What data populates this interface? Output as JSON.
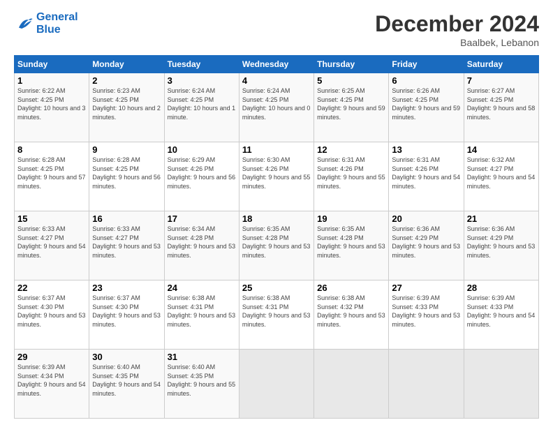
{
  "header": {
    "logo_line1": "General",
    "logo_line2": "Blue",
    "month": "December 2024",
    "location": "Baalbek, Lebanon"
  },
  "weekdays": [
    "Sunday",
    "Monday",
    "Tuesday",
    "Wednesday",
    "Thursday",
    "Friday",
    "Saturday"
  ],
  "weeks": [
    [
      {
        "day": "1",
        "sunrise": "6:22 AM",
        "sunset": "4:25 PM",
        "daylight": "10 hours and 3 minutes."
      },
      {
        "day": "2",
        "sunrise": "6:23 AM",
        "sunset": "4:25 PM",
        "daylight": "10 hours and 2 minutes."
      },
      {
        "day": "3",
        "sunrise": "6:24 AM",
        "sunset": "4:25 PM",
        "daylight": "10 hours and 1 minute."
      },
      {
        "day": "4",
        "sunrise": "6:24 AM",
        "sunset": "4:25 PM",
        "daylight": "10 hours and 0 minutes."
      },
      {
        "day": "5",
        "sunrise": "6:25 AM",
        "sunset": "4:25 PM",
        "daylight": "9 hours and 59 minutes."
      },
      {
        "day": "6",
        "sunrise": "6:26 AM",
        "sunset": "4:25 PM",
        "daylight": "9 hours and 59 minutes."
      },
      {
        "day": "7",
        "sunrise": "6:27 AM",
        "sunset": "4:25 PM",
        "daylight": "9 hours and 58 minutes."
      }
    ],
    [
      {
        "day": "8",
        "sunrise": "6:28 AM",
        "sunset": "4:25 PM",
        "daylight": "9 hours and 57 minutes."
      },
      {
        "day": "9",
        "sunrise": "6:28 AM",
        "sunset": "4:25 PM",
        "daylight": "9 hours and 56 minutes."
      },
      {
        "day": "10",
        "sunrise": "6:29 AM",
        "sunset": "4:26 PM",
        "daylight": "9 hours and 56 minutes."
      },
      {
        "day": "11",
        "sunrise": "6:30 AM",
        "sunset": "4:26 PM",
        "daylight": "9 hours and 55 minutes."
      },
      {
        "day": "12",
        "sunrise": "6:31 AM",
        "sunset": "4:26 PM",
        "daylight": "9 hours and 55 minutes."
      },
      {
        "day": "13",
        "sunrise": "6:31 AM",
        "sunset": "4:26 PM",
        "daylight": "9 hours and 54 minutes."
      },
      {
        "day": "14",
        "sunrise": "6:32 AM",
        "sunset": "4:27 PM",
        "daylight": "9 hours and 54 minutes."
      }
    ],
    [
      {
        "day": "15",
        "sunrise": "6:33 AM",
        "sunset": "4:27 PM",
        "daylight": "9 hours and 54 minutes."
      },
      {
        "day": "16",
        "sunrise": "6:33 AM",
        "sunset": "4:27 PM",
        "daylight": "9 hours and 53 minutes."
      },
      {
        "day": "17",
        "sunrise": "6:34 AM",
        "sunset": "4:28 PM",
        "daylight": "9 hours and 53 minutes."
      },
      {
        "day": "18",
        "sunrise": "6:35 AM",
        "sunset": "4:28 PM",
        "daylight": "9 hours and 53 minutes."
      },
      {
        "day": "19",
        "sunrise": "6:35 AM",
        "sunset": "4:28 PM",
        "daylight": "9 hours and 53 minutes."
      },
      {
        "day": "20",
        "sunrise": "6:36 AM",
        "sunset": "4:29 PM",
        "daylight": "9 hours and 53 minutes."
      },
      {
        "day": "21",
        "sunrise": "6:36 AM",
        "sunset": "4:29 PM",
        "daylight": "9 hours and 53 minutes."
      }
    ],
    [
      {
        "day": "22",
        "sunrise": "6:37 AM",
        "sunset": "4:30 PM",
        "daylight": "9 hours and 53 minutes."
      },
      {
        "day": "23",
        "sunrise": "6:37 AM",
        "sunset": "4:30 PM",
        "daylight": "9 hours and 53 minutes."
      },
      {
        "day": "24",
        "sunrise": "6:38 AM",
        "sunset": "4:31 PM",
        "daylight": "9 hours and 53 minutes."
      },
      {
        "day": "25",
        "sunrise": "6:38 AM",
        "sunset": "4:31 PM",
        "daylight": "9 hours and 53 minutes."
      },
      {
        "day": "26",
        "sunrise": "6:38 AM",
        "sunset": "4:32 PM",
        "daylight": "9 hours and 53 minutes."
      },
      {
        "day": "27",
        "sunrise": "6:39 AM",
        "sunset": "4:33 PM",
        "daylight": "9 hours and 53 minutes."
      },
      {
        "day": "28",
        "sunrise": "6:39 AM",
        "sunset": "4:33 PM",
        "daylight": "9 hours and 54 minutes."
      }
    ],
    [
      {
        "day": "29",
        "sunrise": "6:39 AM",
        "sunset": "4:34 PM",
        "daylight": "9 hours and 54 minutes."
      },
      {
        "day": "30",
        "sunrise": "6:40 AM",
        "sunset": "4:35 PM",
        "daylight": "9 hours and 54 minutes."
      },
      {
        "day": "31",
        "sunrise": "6:40 AM",
        "sunset": "4:35 PM",
        "daylight": "9 hours and 55 minutes."
      },
      null,
      null,
      null,
      null
    ]
  ]
}
